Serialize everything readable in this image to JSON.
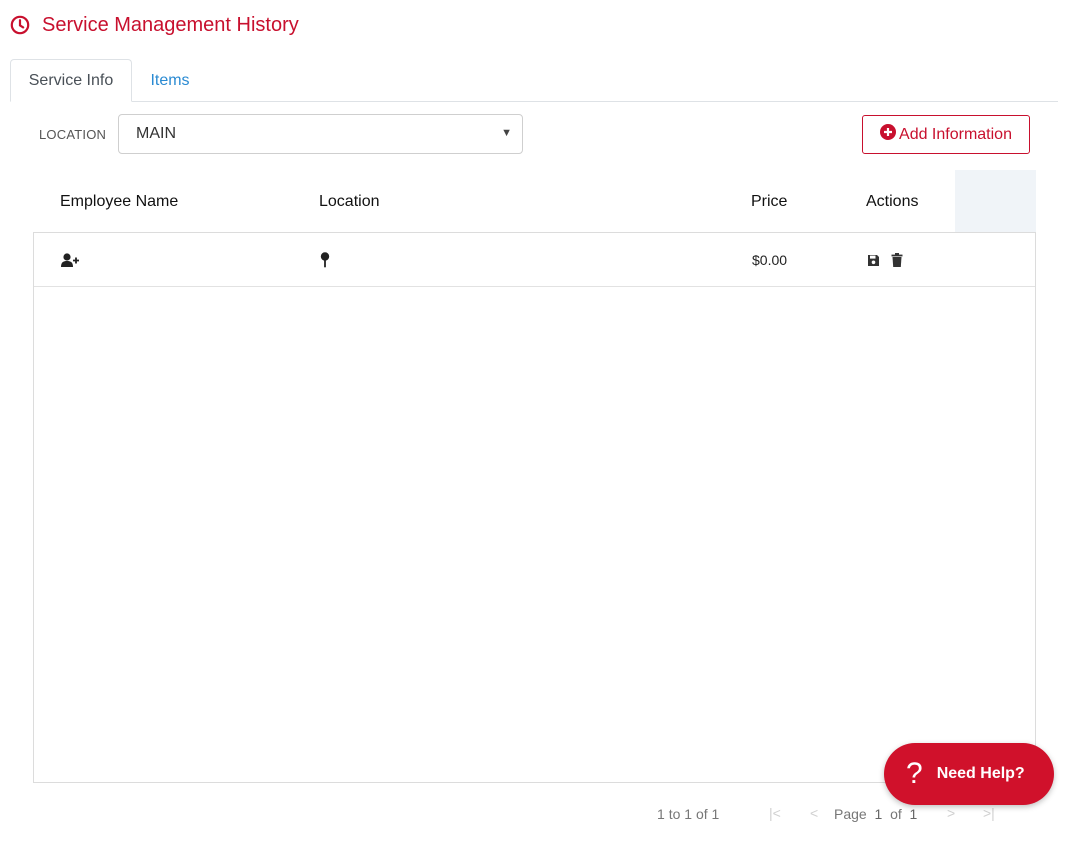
{
  "header": {
    "title": "Service Management History",
    "icon": "clock-icon",
    "accent": "#c8102e"
  },
  "tabs": [
    {
      "label": "Service Info",
      "active": true
    },
    {
      "label": "Items",
      "active": false
    }
  ],
  "location": {
    "label": "LOCATION",
    "selected": "MAIN"
  },
  "add_button": {
    "label": "Add Information",
    "icon": "plus-circle-icon"
  },
  "grid": {
    "columns": [
      "Employee Name",
      "Location",
      "Price",
      "Actions"
    ],
    "rows": [
      {
        "employee_icon": "user-plus-icon",
        "location_icon": "map-pin-icon",
        "price": "$0.00",
        "actions": [
          "save-icon",
          "trash-icon"
        ]
      }
    ]
  },
  "pager": {
    "summary_from": "1",
    "summary_to_word": "to",
    "summary_to": "1",
    "summary_of_word": "of",
    "summary_total": "1",
    "page_word": "Page",
    "page": "1",
    "of_word": "of",
    "pages": "1"
  },
  "help": {
    "label": "Need Help?",
    "glyph": "?"
  }
}
